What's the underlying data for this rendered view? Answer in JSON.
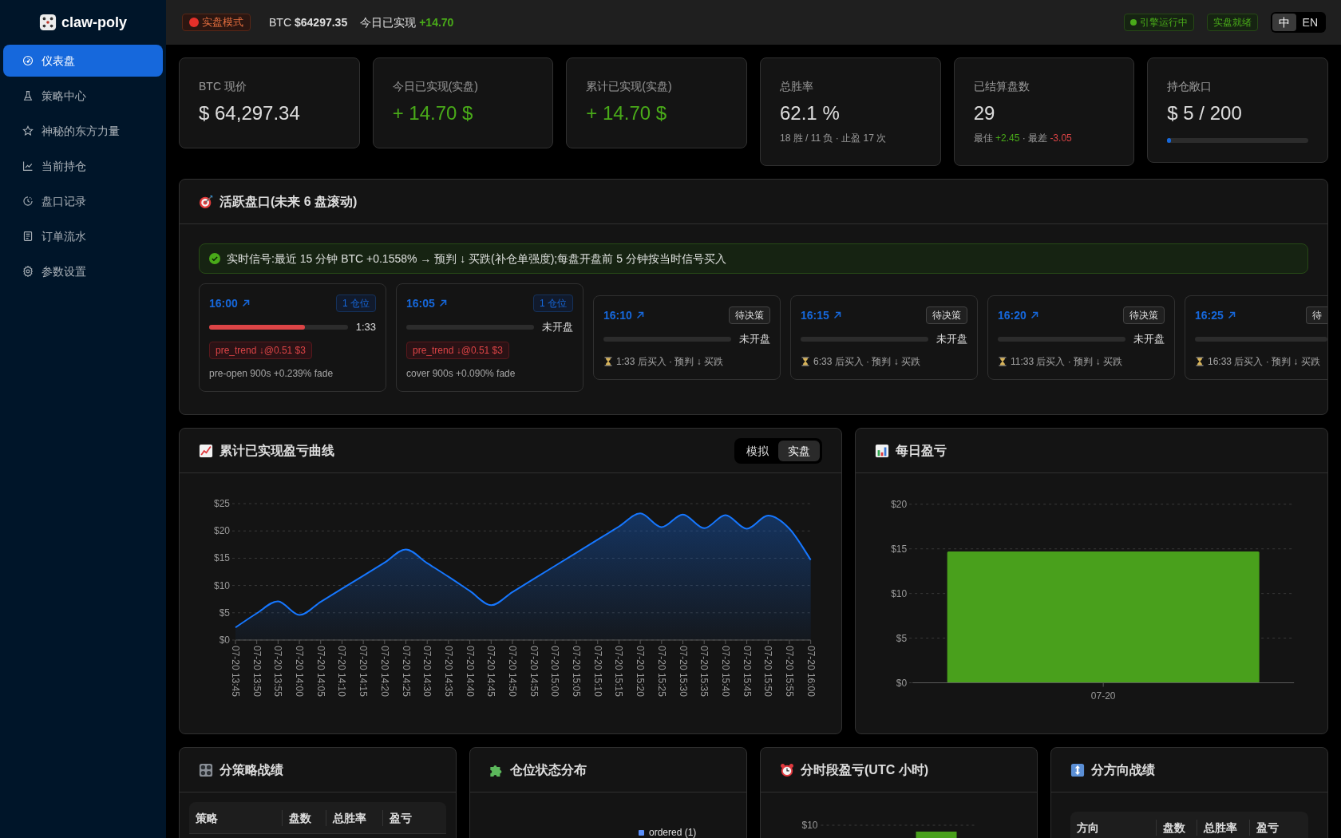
{
  "sidebar": {
    "logo": "claw-poly",
    "items": [
      {
        "label": "仪表盘",
        "selected": true
      },
      {
        "label": "策略中心",
        "selected": false
      },
      {
        "label": "神秘的东方力量",
        "selected": false
      },
      {
        "label": "当前持仓",
        "selected": false
      },
      {
        "label": "盘口记录",
        "selected": false
      },
      {
        "label": "订单流水",
        "selected": false
      },
      {
        "label": "参数设置",
        "selected": false
      }
    ]
  },
  "header": {
    "mode_badge": "实盘模式",
    "btc": {
      "label": "BTC",
      "value": "$64297.35"
    },
    "today": {
      "label": "今日已实现",
      "value": "+14.70"
    },
    "status_badges": [
      {
        "text": "引擎运行中",
        "dot": true
      },
      {
        "text": "实盘就绪",
        "dot": false
      }
    ],
    "languages": [
      {
        "label": "中",
        "selected": true
      },
      {
        "label": "EN",
        "selected": false
      }
    ]
  },
  "stats": [
    {
      "label": "BTC 现价",
      "value": "$ 64,297.34",
      "kind": "price"
    },
    {
      "label": "今日已实现(实盘)",
      "value": "+ 14.70 $",
      "kind": "pnl"
    },
    {
      "label": "累计已实现(实盘)",
      "value": "+ 14.70 $",
      "kind": "pnl"
    },
    {
      "label": "总胜率",
      "value": "62.1 %",
      "kind": "rate",
      "detail": [
        {
          "text": "18 胜 / 11 负 · 止盈 17 次",
          "kind": "label"
        }
      ]
    },
    {
      "label": "已结算盘数",
      "value": "29",
      "kind": "count",
      "detail": [
        {
          "text": "最佳 ",
          "kind": "label"
        },
        {
          "text": "+2.45",
          "kind": "gain"
        },
        {
          "text": " · 最差 ",
          "kind": "label"
        },
        {
          "text": "-3.05",
          "kind": "loss"
        }
      ]
    },
    {
      "label": "持仓敞口",
      "value": "$ 5 / 200",
      "kind": "exposure",
      "level": 0.025
    }
  ],
  "active_markets": {
    "title": "活跃盘口(未来 6 盘滚动)",
    "signal": "实时信号:最近 15 分钟 BTC +0.1558% → 预判 ↓ 买跌(补仓单强度);每盘开盘前 5 分钟按当时信号买入",
    "markets": [
      {
        "time": "16:00",
        "tag": "1 仓位",
        "level": 0.69,
        "reading": "1:33",
        "kind": "ordered",
        "order": "pre_trend ↓@0.51 $3",
        "note": "pre-open 900s +0.239% fade",
        "cut_off": false
      },
      {
        "time": "16:05",
        "tag": "1 仓位",
        "reading": "未开盘",
        "kind": "ordered",
        "order": "pre_trend ↓@0.51 $3",
        "note": "cover 900s +0.090% fade",
        "cut_off": false
      },
      {
        "time": "16:10",
        "tag": "待决策",
        "reading": "未开盘",
        "kind": "pending",
        "note": "1:33 后买入 · 预判 ↓ 买跌",
        "cut_off": false
      },
      {
        "time": "16:15",
        "tag": "待决策",
        "reading": "未开盘",
        "kind": "pending",
        "note": "6:33 后买入 · 预判 ↓ 买跌",
        "cut_off": false
      },
      {
        "time": "16:20",
        "tag": "待决策",
        "reading": "未开盘",
        "kind": "pending",
        "note": "11:33 后买入 · 预判 ↓ 买跌",
        "cut_off": false
      },
      {
        "time": "16:25",
        "tag": "待",
        "kind": "pending",
        "note": "16:33 后买入 · 预判 ↓ 买跌",
        "cut_off": true
      }
    ]
  },
  "pnl_curve": {
    "title": "累计已实现盈亏曲线",
    "modes": [
      {
        "label": "模拟",
        "selected": false
      },
      {
        "label": "实盘",
        "selected": true
      }
    ],
    "chart_data": {
      "type": "area",
      "grid": true,
      "categories": [
        "07-20 13:45",
        "07-20 13:50",
        "07-20 13:55",
        "07-20 14:00",
        "07-20 14:05",
        "07-20 14:10",
        "07-20 14:15",
        "07-20 14:20",
        "07-20 14:25",
        "07-20 14:30",
        "07-20 14:35",
        "07-20 14:40",
        "07-20 14:45",
        "07-20 14:50",
        "07-20 14:55",
        "07-20 15:00",
        "07-20 15:05",
        "07-20 15:10",
        "07-20 15:15",
        "07-20 15:20",
        "07-20 15:25",
        "07-20 15:30",
        "07-20 15:35",
        "07-20 15:40",
        "07-20 15:45",
        "07-20 15:50",
        "07-20 15:55",
        "07-20 16:00"
      ],
      "values": [
        2.3,
        4.9,
        7.1,
        4.6,
        7.0,
        9.4,
        11.8,
        14.2,
        16.6,
        14.1,
        11.6,
        9.0,
        6.4,
        8.8,
        11.2,
        13.6,
        16.0,
        18.4,
        20.8,
        23.2,
        20.7,
        23.0,
        20.5,
        22.9,
        20.4,
        22.8,
        20.4,
        14.7
      ],
      "ylim": [
        0,
        25
      ],
      "yticks": [
        {
          "value": 0,
          "label": "$0"
        },
        {
          "value": 5,
          "label": "$5"
        },
        {
          "value": 10,
          "label": "$10"
        },
        {
          "value": 15,
          "label": "$15"
        },
        {
          "value": 20,
          "label": "$20"
        },
        {
          "value": 25,
          "label": "$25"
        }
      ]
    }
  },
  "daily_pnl": {
    "title": "每日盈亏",
    "chart_data": {
      "type": "bar",
      "grid": true,
      "categories": [
        "07-20"
      ],
      "values": [
        14.7
      ],
      "ylim": [
        0,
        20
      ],
      "yticks": [
        {
          "value": 0,
          "label": "$0"
        },
        {
          "value": 5,
          "label": "$5"
        },
        {
          "value": 10,
          "label": "$10"
        },
        {
          "value": 15,
          "label": "$15"
        },
        {
          "value": 20,
          "label": "$20"
        }
      ]
    }
  },
  "bottom_panels": [
    {
      "title": "分策略战绩",
      "kind": "table",
      "columns": [
        "策略",
        "盘数",
        "总胜率",
        "盈亏"
      ]
    },
    {
      "title": "仓位状态分布",
      "kind": "pie",
      "legend": [
        {
          "label": "ordered (1)",
          "color": "#5b8ff9"
        }
      ]
    },
    {
      "title": "分时段盈亏(UTC 小时)",
      "kind": "hourly_chart",
      "tick_labels": [
        "$10"
      ]
    },
    {
      "title": "分方向战绩",
      "kind": "table",
      "columns": [
        "方向",
        "盘数",
        "总胜率",
        "盈亏"
      ]
    }
  ]
}
